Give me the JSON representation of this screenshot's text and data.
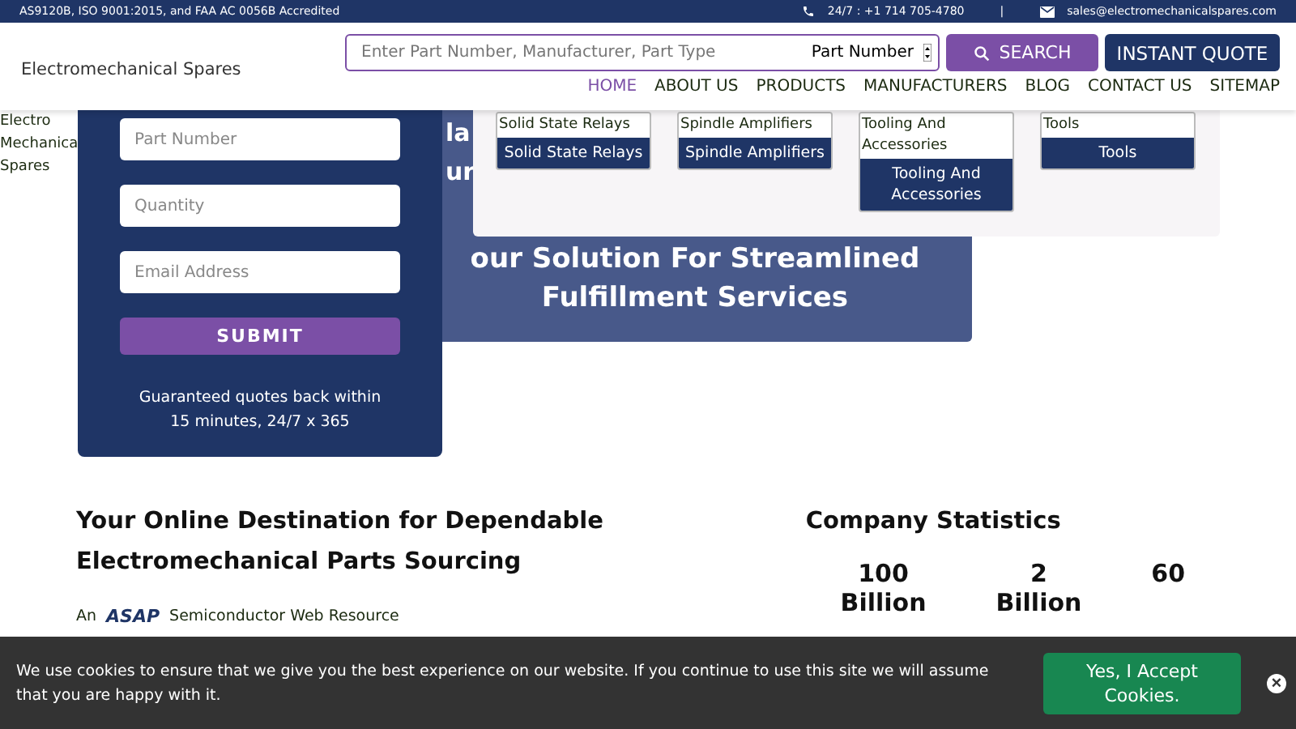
{
  "top_bar": {
    "accreditation": "AS9120B, ISO 9001:2015, and FAA AC 0056B Accredited",
    "phone": "24/7 : +1 714 705-4780",
    "separator": "|",
    "email": "sales@electromechanicalspares.com"
  },
  "header": {
    "logo": "Electromechanical Spares",
    "search": {
      "placeholder": "Enter Part Number, Manufacturer, Part Type",
      "select": "Part Number",
      "button": "SEARCH"
    },
    "quote_button": "INSTANT QUOTE",
    "nav": [
      {
        "label": "HOME",
        "selected": true
      },
      {
        "label": "ABOUT US",
        "selected": false
      },
      {
        "label": "PRODUCTS",
        "selected": false
      },
      {
        "label": "MANUFACTURERS",
        "selected": false
      },
      {
        "label": "BLOG",
        "selected": false
      },
      {
        "label": "CONTACT US",
        "selected": false
      },
      {
        "label": "SITEMAP",
        "selected": false
      }
    ]
  },
  "side_logo": [
    "Electro",
    "Mechanica",
    "Spares"
  ],
  "quote_form": {
    "fields": [
      {
        "placeholder": "Part Number"
      },
      {
        "placeholder": "Quantity"
      },
      {
        "placeholder": "Email Address"
      }
    ],
    "submit": "SUBMIT",
    "note": "Guaranteed quotes back within 15 minutes, 24/7 x 365"
  },
  "hero": {
    "fragments": [
      "la",
      "ur"
    ],
    "title": "our Solution For Streamlined Fulfillment Services"
  },
  "products_menu": [
    {
      "image_alt": "Solid State Relays",
      "label": "Solid State Relays"
    },
    {
      "image_alt": "Spindle Amplifiers",
      "label": "Spindle Amplifiers"
    },
    {
      "image_alt": "Tooling And Accessories",
      "label": "Tooling And Accessories"
    },
    {
      "image_alt": "Tools",
      "label": "Tools"
    }
  ],
  "intro": {
    "heading": "Your Online Destination for Dependable Electromechanical Parts Sourcing",
    "prefix": "An",
    "brand": "ASAP",
    "suffix": "Semiconductor Web Resource"
  },
  "stats": {
    "heading": "Company Statistics",
    "items": [
      {
        "value": "100",
        "unit": "Billion"
      },
      {
        "value": "2",
        "unit": "Billion"
      },
      {
        "value": "60"
      }
    ]
  },
  "cookie_banner": {
    "text": "We use cookies to ensure that we give you the best experience on our website. If you continue to use this site we will assume that you are happy with it.",
    "accept": "Yes, I Accept Cookies.",
    "close": "×"
  }
}
